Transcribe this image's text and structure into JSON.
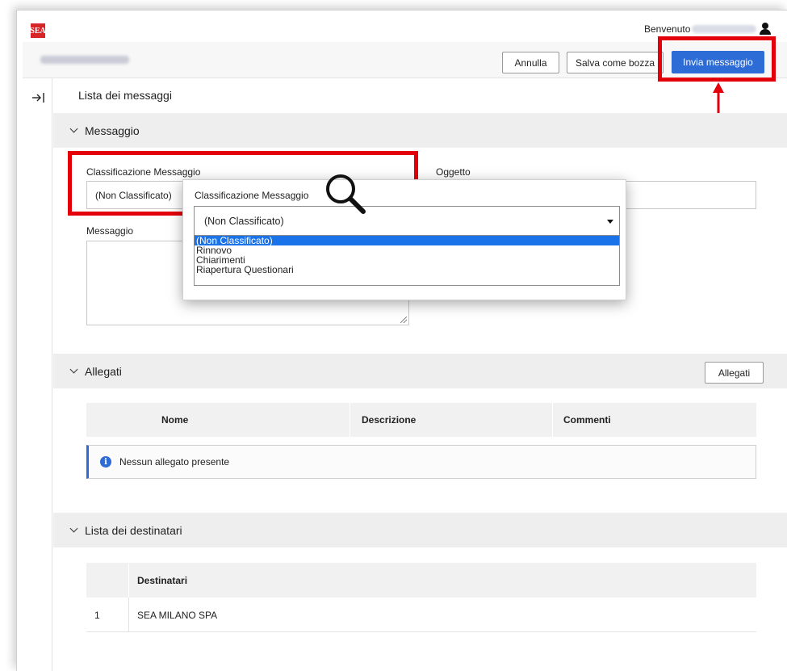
{
  "header": {
    "logo_text": "SEA",
    "welcome_label": "Benvenuto",
    "company_name_obscured": true
  },
  "toolbar": {
    "cancel_label": "Annulla",
    "draft_label": "Salva come bozza",
    "send_label": "Invia messaggio"
  },
  "breadcrumb": "Lista dei messaggi",
  "sections": {
    "message": "Messaggio",
    "attachments": "Allegati",
    "recipients": "Lista dei destinatari"
  },
  "form": {
    "classification_label": "Classificazione Messaggio",
    "classification_value": "(Non Classificato)",
    "subject_label": "Oggetto",
    "subject_value": "",
    "message_label": "Messaggio"
  },
  "dropdown": {
    "label": "Classificazione Messaggio",
    "selected": "(Non Classificato)",
    "options": [
      "(Non Classificato)",
      "Rinnovo",
      "Chiarimenti",
      "Riapertura Questionari"
    ]
  },
  "attachments": {
    "add_button_label": "Allegati",
    "columns": [
      "Nome",
      "Descrizione",
      "Commenti"
    ],
    "empty_message": "Nessun allegato presente"
  },
  "recipients": {
    "columns": [
      "Destinatari"
    ],
    "rows": [
      {
        "index": "1",
        "name": "SEA MILANO SPA"
      }
    ]
  },
  "colors": {
    "primary": "#2d6bd6",
    "highlight_red": "#e3000b",
    "selected_option": "#1a73e8"
  },
  "icons": [
    "user-icon",
    "collapse-sidebar-icon",
    "chevron-down-icon",
    "magnifier-icon",
    "info-icon",
    "caret-down-icon",
    "arrow-up-icon"
  ]
}
